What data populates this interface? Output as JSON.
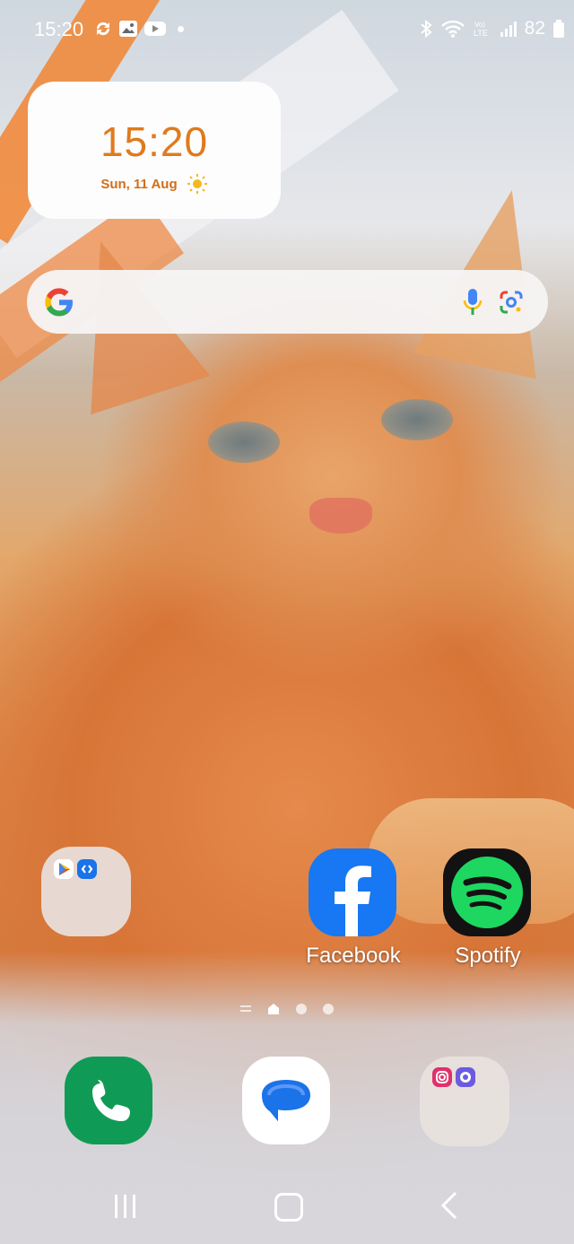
{
  "status_bar": {
    "time": "15:20",
    "battery": "82",
    "left_icons": [
      "sync-icon",
      "gallery-icon",
      "youtube-icon",
      "notification-dot"
    ],
    "right_icons": [
      "bluetooth-icon",
      "wifi-icon",
      "volte-icon",
      "signal-icon",
      "battery-icon"
    ]
  },
  "clock_widget": {
    "time": "15:20",
    "date": "Sun, 11 Aug",
    "weather_icon": "sun-icon"
  },
  "search_bar": {
    "icons": [
      "google-icon",
      "mic-icon",
      "lens-icon"
    ]
  },
  "home_apps": [
    {
      "label": "",
      "type": "folder",
      "contents": [
        "play-store-icon",
        "shazam-icon"
      ]
    },
    {
      "label": "Facebook",
      "type": "app",
      "icon": "facebook-icon"
    },
    {
      "label": "Spotify",
      "type": "app",
      "icon": "spotify-icon"
    }
  ],
  "pager": {
    "pages": 3,
    "current": 1
  },
  "dock": [
    {
      "label": "",
      "icon": "phone-icon"
    },
    {
      "label": "",
      "icon": "messages-icon"
    },
    {
      "label": "",
      "type": "folder",
      "contents": [
        "instagram-icon",
        "galaxy-store-icon"
      ]
    }
  ],
  "colors": {
    "clock_accent": "#e07a1e",
    "facebook": "#1877f2",
    "spotify_green": "#1ed760",
    "phone_green": "#0f9b55"
  }
}
